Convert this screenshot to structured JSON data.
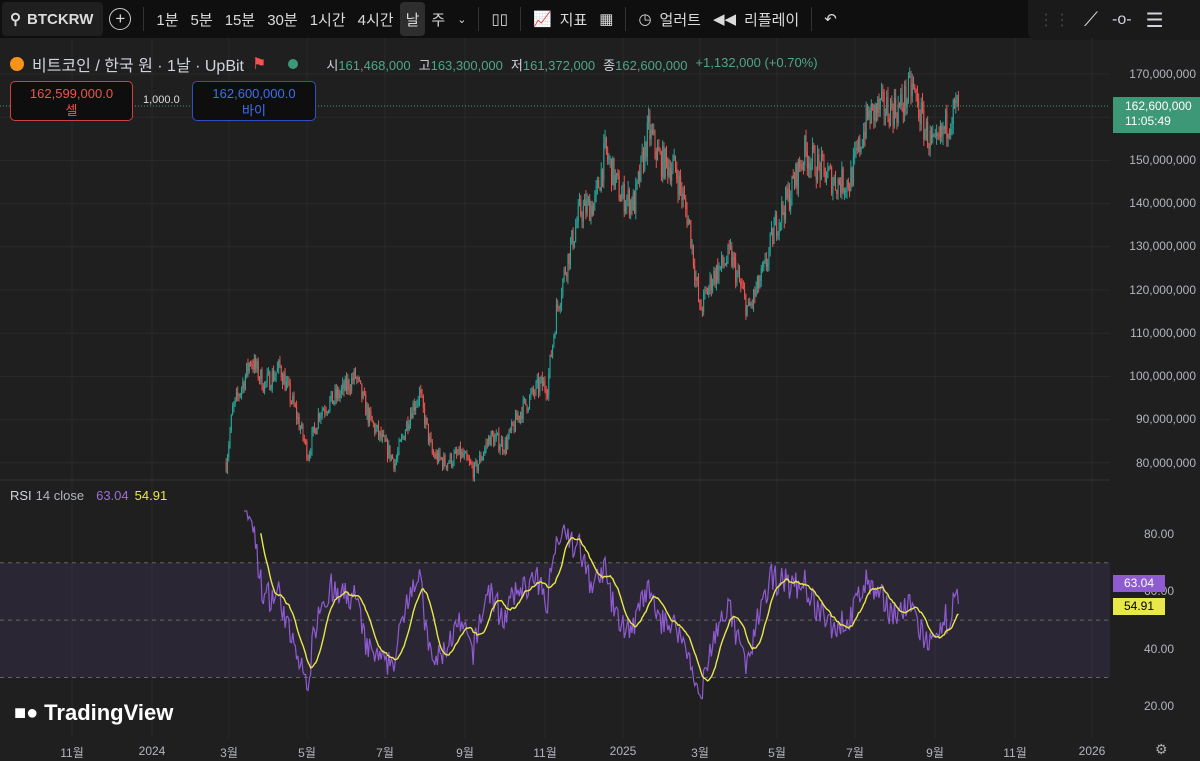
{
  "toolbar": {
    "symbol": "BTCKRW",
    "intervals": [
      "1분",
      "5분",
      "15분",
      "30분",
      "1시간",
      "4시간",
      "날",
      "주"
    ],
    "active_interval": "날",
    "indicators": "지표",
    "alert": "얼러트",
    "replay": "리플레이"
  },
  "legend": {
    "title": "비트코인 / 한국 원 · 1날 · UpBit",
    "open_label": "시",
    "open": "161,468,000",
    "high_label": "고",
    "high": "163,300,000",
    "low_label": "저",
    "low": "161,372,000",
    "close_label": "종",
    "close": "162,600,000",
    "change": "+1,132,000 (+0.70%)"
  },
  "trade": {
    "sell_price": "162,599,000.0",
    "sell_label": "셀",
    "spread": "1,000.0",
    "buy_price": "162,600,000.0",
    "buy_label": "바이"
  },
  "price_axis": {
    "labels": [
      "170,000,000",
      "150,000,000",
      "140,000,000",
      "130,000,000",
      "120,000,000",
      "110,000,000",
      "100,000,000",
      "90,000,000",
      "80,000,000"
    ],
    "last_price": "162,600,000",
    "countdown": "11:05:49"
  },
  "rsi": {
    "label": "RSI",
    "params": "14 close",
    "value": "63.04",
    "ma_value": "54.91",
    "axis": [
      "80.00",
      "60.00",
      "40.00",
      "20.00"
    ]
  },
  "x_axis": [
    "11월",
    "2024",
    "3월",
    "5월",
    "7월",
    "9월",
    "11월",
    "2025",
    "3월",
    "5월",
    "7월",
    "9월",
    "11월",
    "2026"
  ],
  "brand": "TradingView",
  "colors": {
    "up": "#26a69a",
    "down": "#ef5350",
    "rsi": "#8e5bd0",
    "rsi_ma": "#e8e84a",
    "last": "#3d9878"
  },
  "chart_data": {
    "type": "candlestick",
    "title": "BTCKRW 1D",
    "ylim": [
      77000000,
      172000000
    ],
    "rsi_ylim": [
      15,
      88
    ],
    "closes": [
      [
        "2024-02-26",
        80000000
      ],
      [
        "2024-03-02",
        92000000
      ],
      [
        "2024-03-12",
        100000000
      ],
      [
        "2024-03-16",
        104000000
      ],
      [
        "2024-03-27",
        98000000
      ],
      [
        "2024-04-08",
        102000000
      ],
      [
        "2024-04-20",
        92000000
      ],
      [
        "2024-04-30",
        82000000
      ],
      [
        "2024-05-09",
        92000000
      ],
      [
        "2024-05-25",
        96000000
      ],
      [
        "2024-06-06",
        100000000
      ],
      [
        "2024-06-17",
        90000000
      ],
      [
        "2024-06-29",
        84000000
      ],
      [
        "2024-07-07",
        80000000
      ],
      [
        "2024-07-19",
        92000000
      ],
      [
        "2024-07-26",
        96000000
      ],
      [
        "2024-08-05",
        82000000
      ],
      [
        "2024-08-15",
        80000000
      ],
      [
        "2024-08-27",
        82000000
      ],
      [
        "2024-09-07",
        78000000
      ],
      [
        "2024-09-19",
        86000000
      ],
      [
        "2024-10-01",
        84000000
      ],
      [
        "2024-10-13",
        92000000
      ],
      [
        "2024-10-28",
        98000000
      ],
      [
        "2024-11-03",
        98000000
      ],
      [
        "2024-11-10",
        115000000
      ],
      [
        "2024-11-17",
        125000000
      ],
      [
        "2024-11-28",
        138000000
      ],
      [
        "2024-12-10",
        140000000
      ],
      [
        "2024-12-18",
        152000000
      ],
      [
        "2024-12-30",
        142000000
      ],
      [
        "2025-01-10",
        140000000
      ],
      [
        "2025-01-21",
        157000000
      ],
      [
        "2025-01-30",
        150000000
      ],
      [
        "2025-02-11",
        148000000
      ],
      [
        "2025-02-22",
        135000000
      ],
      [
        "2025-03-02",
        115000000
      ],
      [
        "2025-03-12",
        123000000
      ],
      [
        "2025-03-26",
        128000000
      ],
      [
        "2025-04-09",
        115000000
      ],
      [
        "2025-04-22",
        125000000
      ],
      [
        "2025-04-30",
        135000000
      ],
      [
        "2025-05-11",
        142000000
      ],
      [
        "2025-05-23",
        152000000
      ],
      [
        "2025-06-04",
        148000000
      ],
      [
        "2025-06-16",
        145000000
      ],
      [
        "2025-06-27",
        145000000
      ],
      [
        "2025-07-11",
        160000000
      ],
      [
        "2025-07-21",
        162000000
      ],
      [
        "2025-08-05",
        162000000
      ],
      [
        "2025-08-15",
        167000000
      ],
      [
        "2025-08-25",
        157000000
      ],
      [
        "2025-09-02",
        152000000
      ],
      [
        "2025-09-13",
        160000000
      ],
      [
        "2025-09-20",
        162600000
      ]
    ]
  }
}
